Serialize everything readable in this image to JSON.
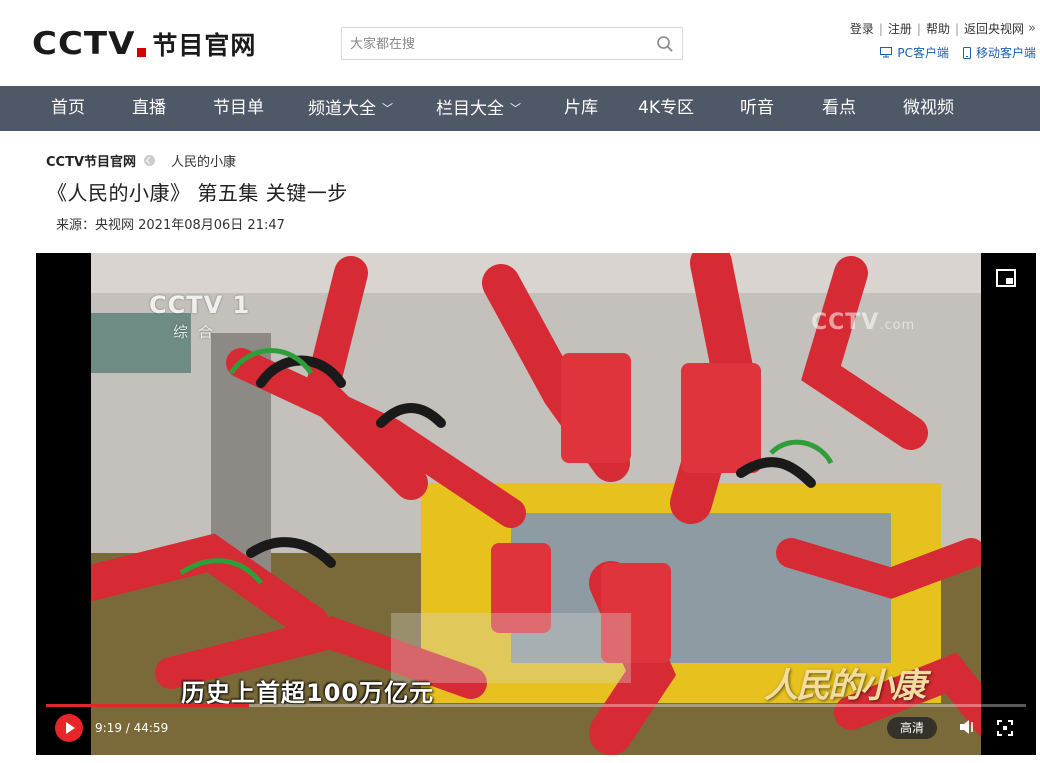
{
  "header": {
    "logo_text": "CCTV",
    "logo_cn": "节目官网",
    "search_placeholder": "大家都在搜",
    "user_links": [
      "登录",
      "注册",
      "帮助",
      "返回央视网"
    ],
    "client_links": [
      "PC客户端",
      "移动客户端"
    ]
  },
  "nav": {
    "items": [
      {
        "label": "首页",
        "has_dropdown": false
      },
      {
        "label": "直播",
        "has_dropdown": false
      },
      {
        "label": "节目单",
        "has_dropdown": false
      },
      {
        "label": "频道大全",
        "has_dropdown": true
      },
      {
        "label": "栏目大全",
        "has_dropdown": true
      },
      {
        "label": "片库",
        "has_dropdown": false
      },
      {
        "label": "4K专区",
        "has_dropdown": false
      },
      {
        "label": "听音",
        "has_dropdown": false
      },
      {
        "label": "看点",
        "has_dropdown": false
      },
      {
        "label": "微视频",
        "has_dropdown": false
      }
    ]
  },
  "breadcrumb": {
    "home": "CCTV节目官网",
    "current": "人民的小康"
  },
  "article": {
    "title": "《人民的小康》 第五集 关键一步",
    "meta": "来源：央视网 2021年08月06日 21:47"
  },
  "player": {
    "watermark_left": "CCTV 1",
    "watermark_left_sub": "综合",
    "watermark_right": "CCTV",
    "watermark_right_suffix": ".com",
    "subtitle": "历史上首超100万亿元",
    "show_logo": "人民的小康",
    "current_time": "9:19",
    "duration": "44:59",
    "time_display": "9:19 / 44:59",
    "progress_fraction": 0.207,
    "quality": "高清"
  },
  "colors": {
    "nav_bg": "#4f5866",
    "accent_red": "#e32626",
    "link_blue": "#1a5fb4"
  }
}
